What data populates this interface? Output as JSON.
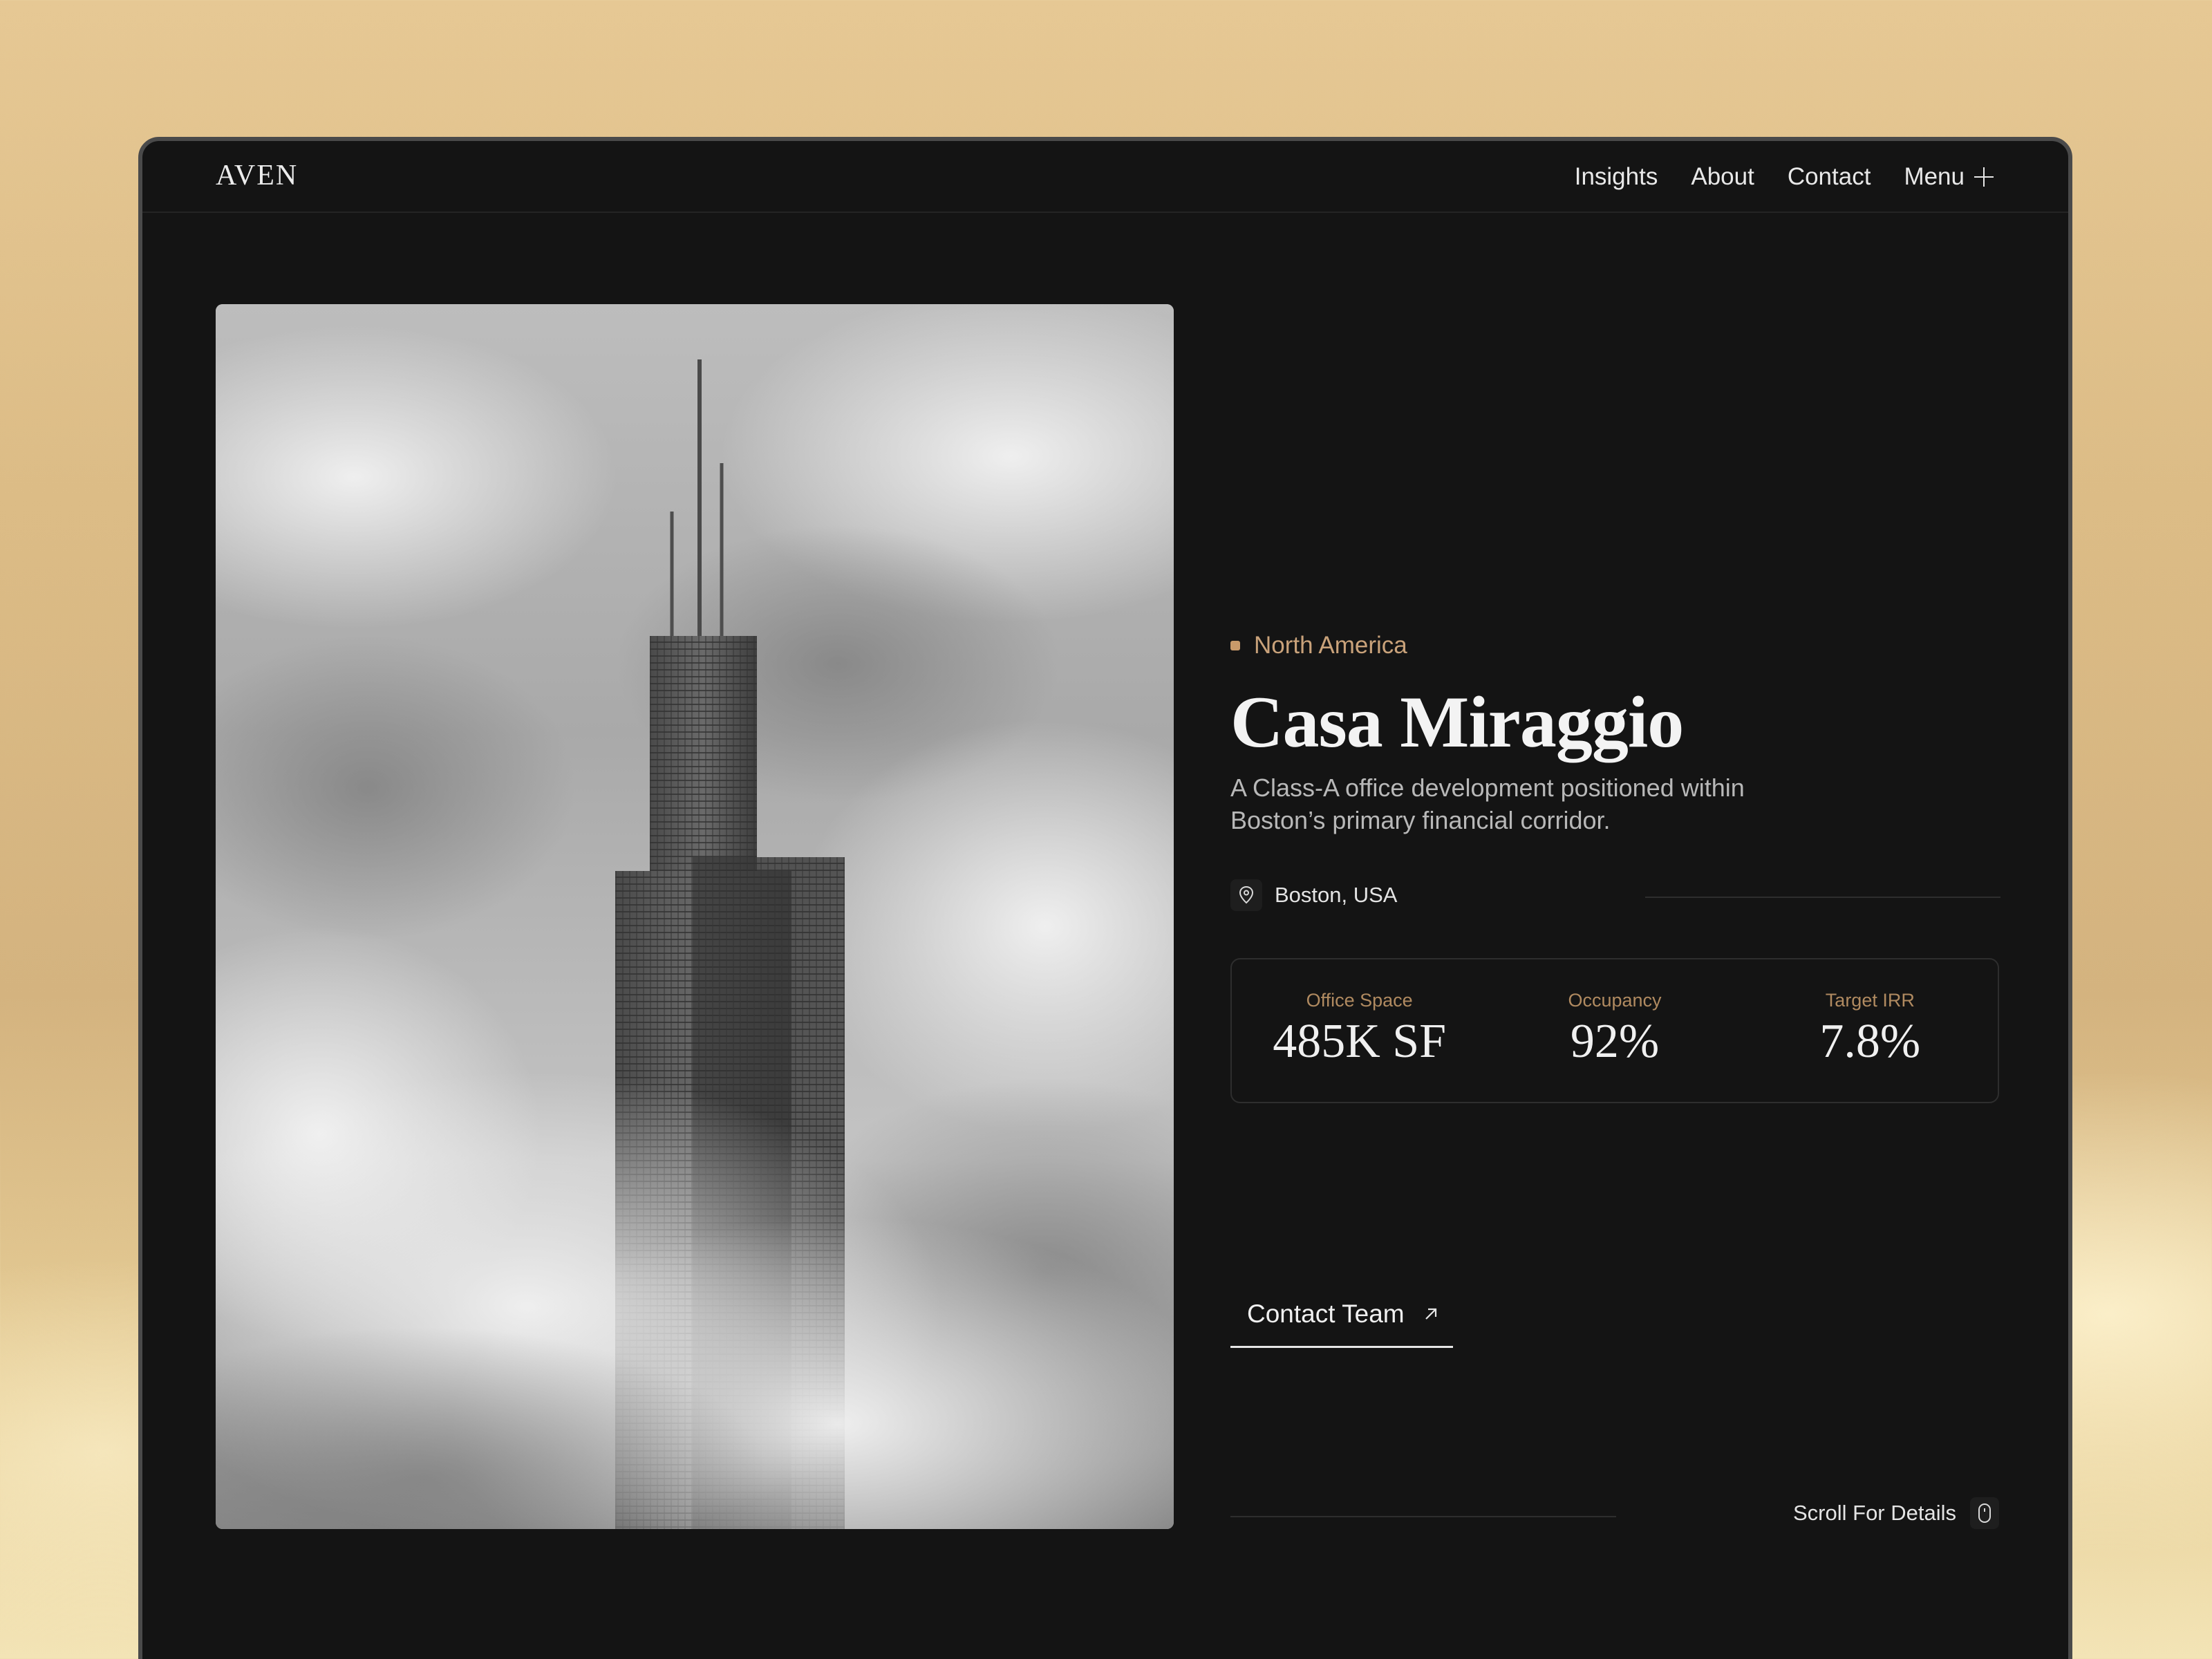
{
  "header": {
    "logo": "AVEN",
    "nav": [
      "Insights",
      "About",
      "Contact"
    ],
    "menu_label": "Menu"
  },
  "hero": {
    "image": "skyscraper-in-clouds"
  },
  "property": {
    "region": "North America",
    "title": "Casa Miraggio",
    "description": "A Class-A office development positioned within Boston’s primary financial corridor.",
    "location": "Boston, USA",
    "stats": [
      {
        "label": "Office Space",
        "value": "485K SF"
      },
      {
        "label": "Occupancy",
        "value": "92%"
      },
      {
        "label": "Target IRR",
        "value": "7.8%"
      }
    ],
    "cta_label": "Contact Team",
    "scroll_label": "Scroll For Details"
  },
  "colors": {
    "accent": "#c99a6a",
    "background": "#141414",
    "frame_border": "#4a4a4a"
  },
  "icons": {
    "menu": "plus-icon",
    "location": "map-pin-icon",
    "cta": "arrow-up-right-icon",
    "scroll": "mouse-icon"
  }
}
